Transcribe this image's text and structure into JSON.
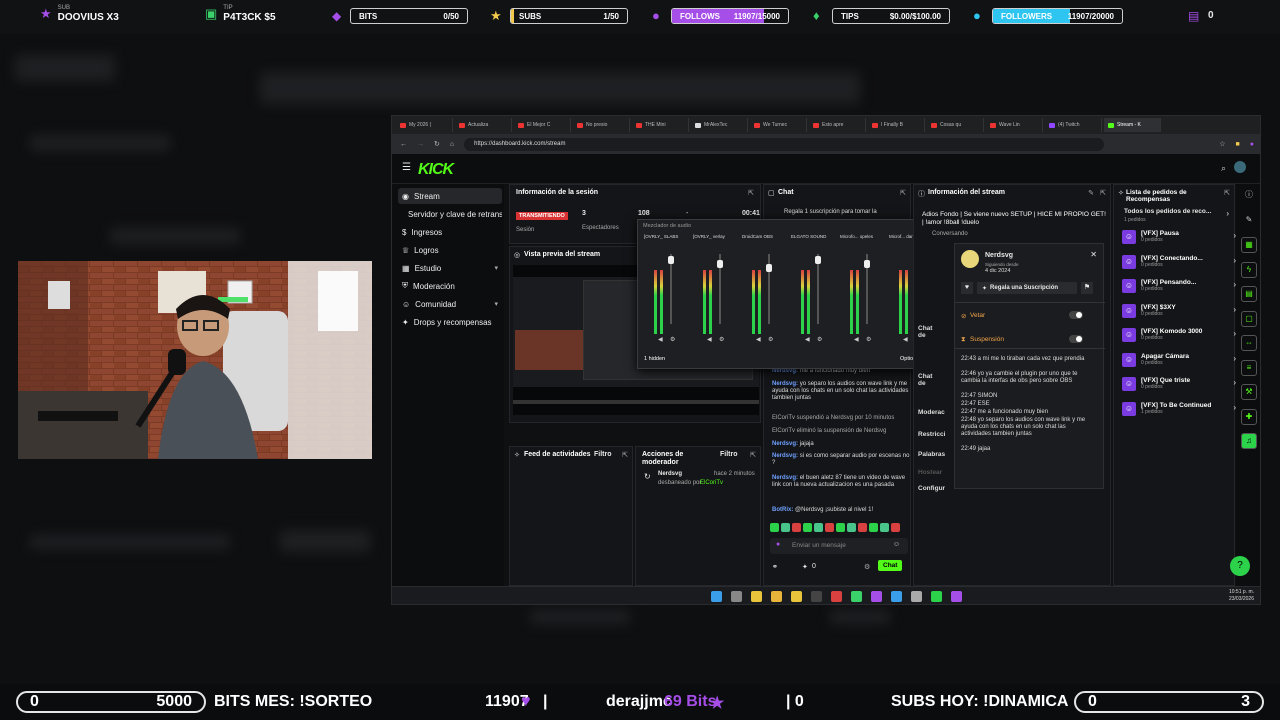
{
  "topbar": {
    "sub_label": "SUB",
    "sub_name": "DOOVIUS X3",
    "tip_label": "TIP",
    "tip_name": "P4T3CK $5",
    "bits": {
      "label": "BITS",
      "value": "0/50"
    },
    "subs": {
      "label": "SUBS",
      "value": "1/50"
    },
    "follows": {
      "label": "FOLLOWS",
      "value": "11907/15000",
      "progress": 0.79
    },
    "tips": {
      "label": "TIPS",
      "value": "$0.00/$100.00"
    },
    "followers": {
      "label": "FOLLOWERS",
      "value": "11907/20000",
      "progress": 0.6
    },
    "counter": "0",
    "accent_purple": "#a64ee8",
    "accent_cyan": "#2ec6f0"
  },
  "browser": {
    "tabs": [
      "My 2026 (",
      "Actualiza",
      "El Mejor C",
      "No presio",
      "THE Mini",
      "MrAlexTec",
      "We Turnec",
      "Esto apre",
      "I Finally B",
      "Cosas qu",
      "Wave Lin",
      "(4) Twitch",
      "Stream - K"
    ],
    "url": "https://dashboard.kick.com/stream"
  },
  "kick": {
    "logo": "KICK",
    "nav": [
      {
        "label": "Stream",
        "icon": "stream-icon"
      },
      {
        "label": "Servidor y clave de retransm",
        "icon": ""
      },
      {
        "label": "Ingresos",
        "icon": "money-icon"
      },
      {
        "label": "Logros",
        "icon": "trophy-icon"
      },
      {
        "label": "Estudio",
        "icon": "studio-icon"
      },
      {
        "label": "Moderación",
        "icon": "shield-icon"
      },
      {
        "label": "Comunidad",
        "icon": "community-icon"
      },
      {
        "label": "Drops y recompensas",
        "icon": "gift-icon"
      }
    ],
    "session": {
      "title": "Información de la sesión",
      "live_badge": "TRANSMITIENDO",
      "session_label": "Sesión",
      "viewers_value": "3",
      "viewers_label": "Espectadores",
      "followers_value": "108",
      "dash": "-",
      "time": "00:41"
    },
    "preview_title": "Vista previa del stream",
    "feed": {
      "title": "Feed de actividades",
      "filter": "Filtro"
    },
    "modactions": {
      "title": "Acciones de moderador",
      "filter": "Filtro",
      "user": "Nerdsvg",
      "time": "hace 2 minutos",
      "action": "desbaneado por",
      "by": "ElCoriTv"
    },
    "mixer": {
      "title": "Mezclador de audio",
      "channels": [
        "[OVRLY_ SLABS",
        "[OVRLY_ verlay",
        "DroidCam OBS",
        "ELGATO SOUND",
        "Microfo... opeles",
        "Microf... darlos"
      ],
      "hidden": "1 hidden",
      "options": "Options"
    },
    "chat": {
      "title": "Chat",
      "gift_text": "Regala 1 suscripción para tomar la",
      "lines": [
        {
          "user": "Nerdsvg:",
          "text": "me a funcionado muy bien"
        },
        {
          "user": "Nerdsvg:",
          "text": "yo separo los audios con wave link y me ayuda con los chats en un solo chat las actividades tambien juntas"
        },
        {
          "user": "",
          "text": "ElCoriTv suspendió a Nerdsvg por 10 minutos"
        },
        {
          "user": "",
          "text": "ElCoriTv eliminó la suspensión de Nerdsvg"
        },
        {
          "user": "Nerdsvg:",
          "text": "jajaja"
        },
        {
          "user": "Nerdsvg:",
          "text": "si es como separar audio por escenas no ?"
        },
        {
          "user": "Nerdsvg:",
          "text": "el buen aletz 87 tiene un video de wave link con la nueva actualizacion es una pasada"
        },
        {
          "user": "BotRix:",
          "text": "@Nerdsvg ¡subiste al nivel 1!"
        }
      ],
      "input_placeholder": "Enviar un mensaje",
      "points": "0",
      "send": "Chat"
    },
    "stream_info": {
      "title": "Información del stream",
      "stream_title": "Adios Fondo | Se viene nuevo SETUP | HICE MI PROPIO GET! | !amor !8ball !duelo",
      "category": "Conversando",
      "popup_user": "Nerdsvg",
      "popup_since": "Siguiendo desde",
      "popup_date": "4 dic 2024",
      "gift_button": "Regala una Suscripción",
      "veto": "Vetar",
      "suspend": "Suspensión",
      "side_labels": [
        "Chat de",
        "Chat de",
        "Moderac",
        "Restricci",
        "Palabras",
        "Hostear",
        "Configur"
      ],
      "log": [
        "22:43 a mi me lo tiraban cada vez que prendia",
        "22:46 yo ya cambie el plugin por uno que te cambia la interfas de obs pero sobre OBS",
        "22:47 SIMON",
        "22:47 ESE",
        "22:47 me a funcionado muy bien",
        "22:48 yo separo los audios con wave link y me ayuda con los chats en un solo chat las actividades tambien juntas",
        "22:49 jajaa"
      ]
    },
    "rewards": {
      "title": "Lista de pedidos de Recompensas",
      "all": "Todos los pedidos de reco...",
      "all_count": "1 pedidos",
      "items": [
        {
          "title": "[VFX] Pausa",
          "count": "0 pedidos"
        },
        {
          "title": "[VFX] Conectando...",
          "count": "0 pedidos"
        },
        {
          "title": "[VFX] Pensando...",
          "count": "0 pedidos"
        },
        {
          "title": "[VFX] $3XY",
          "count": "0 pedidos"
        },
        {
          "title": "[VFX] Komodo 3000",
          "count": "0 pedidos"
        },
        {
          "title": "Apagar Cámara",
          "count": "0 pedidos"
        },
        {
          "title": "[VFX] Que triste",
          "count": "0 pedidos"
        },
        {
          "title": "[VFX] To Be Continued",
          "count": "1 pedidos"
        }
      ]
    },
    "clock": {
      "time": "10:51 p. m.",
      "date": "23/03/2026"
    }
  },
  "bottom": {
    "left_min": "0",
    "left_max": "5000",
    "bits_text": "BITS MES: !SORTEO",
    "count": "11907",
    "separator": "|",
    "user": "derajjmc",
    "bits": "69 Bits",
    "zero": "| 0",
    "subs_text": "SUBS HOY: !DINAMICA",
    "right_min": "0",
    "right_max": "3"
  }
}
